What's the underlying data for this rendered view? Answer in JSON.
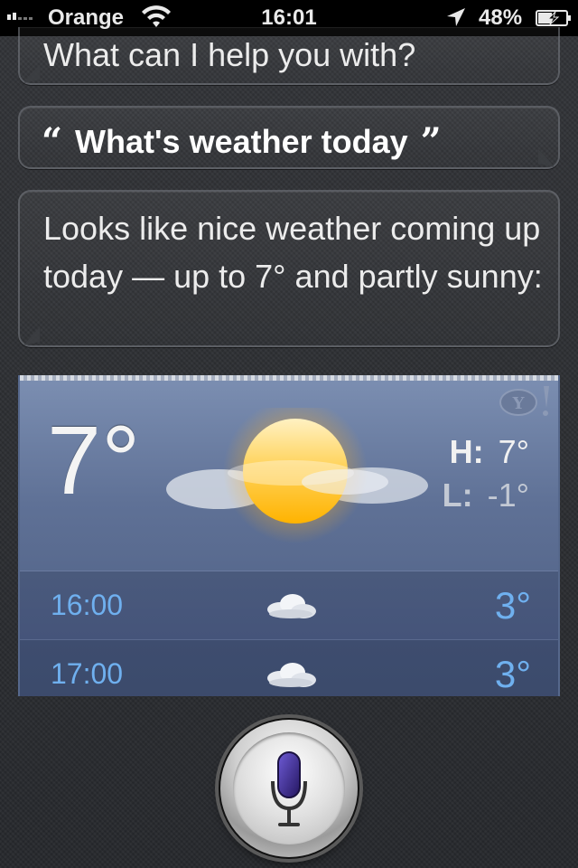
{
  "status_bar": {
    "carrier": "Orange",
    "time": "16:01",
    "battery": "48%"
  },
  "conversation": {
    "prompt": "What can I help you with?",
    "user_query": "What's weather today",
    "open_quote": "“",
    "close_quote": "”",
    "response": "Looks like nice weather coming up today — up to 7° and partly sunny:"
  },
  "weather": {
    "current_temp": "7°",
    "high_label": "H:",
    "high": "7°",
    "low_label": "L:",
    "low": "-1°",
    "condition_icon": "partly-sunny-icon",
    "provider_icon": "yahoo-icon",
    "hourly": [
      {
        "time": "16:00",
        "icon": "cloud-icon",
        "temp": "3°"
      },
      {
        "time": "17:00",
        "icon": "cloud-icon",
        "temp": "3°"
      }
    ]
  },
  "colors": {
    "hour_text": "#6fb0ef",
    "mic_accent": "#3b2a86"
  }
}
